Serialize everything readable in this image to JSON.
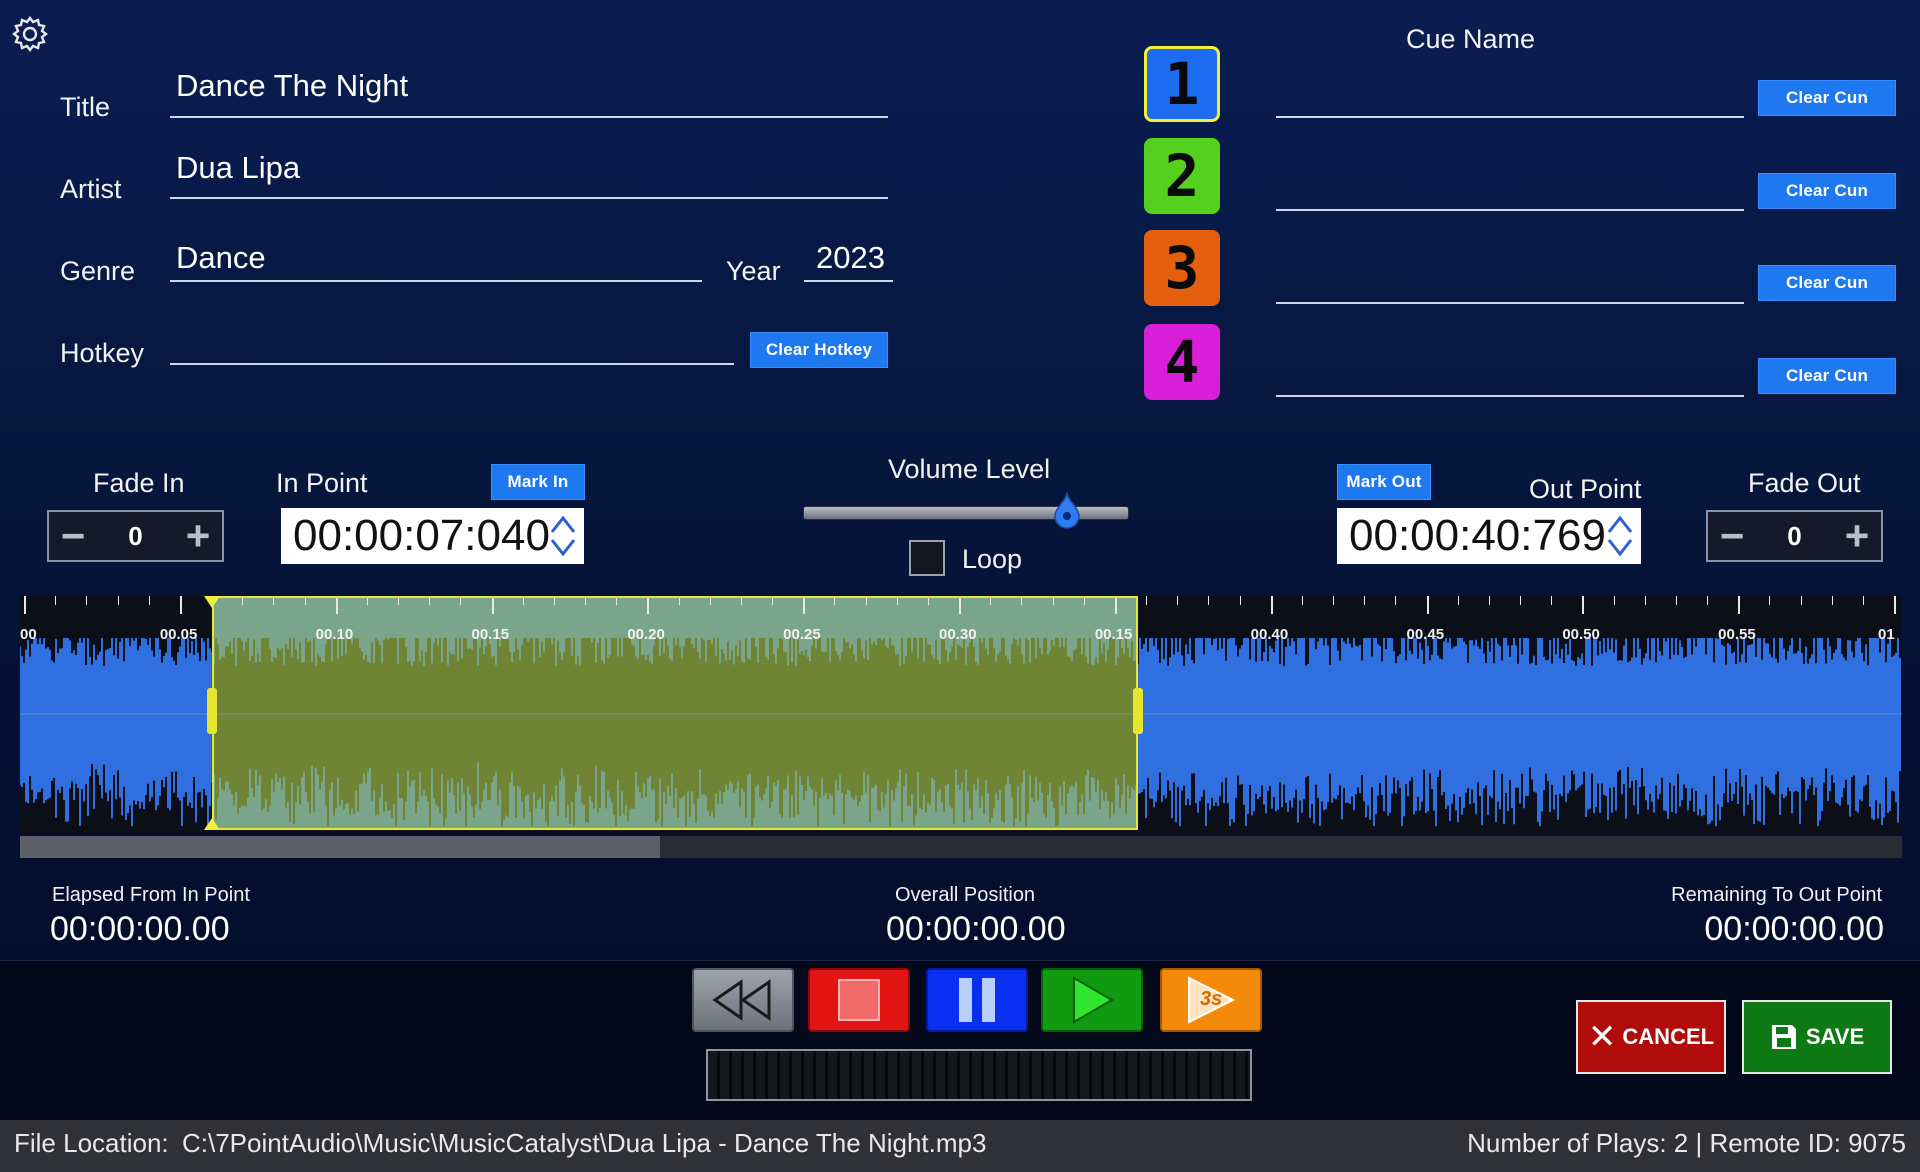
{
  "metadata": {
    "title_label": "Title",
    "title_value": "Dance The Night",
    "artist_label": "Artist",
    "artist_value": "Dua Lipa",
    "genre_label": "Genre",
    "genre_value": "Dance",
    "year_label": "Year",
    "year_value": "2023",
    "hotkey_label": "Hotkey",
    "hotkey_value": "",
    "clear_hotkey_label": "Clear Hotkey"
  },
  "cues": {
    "header": "Cue Name",
    "items": [
      {
        "number": "1",
        "color": "#1e6cf0",
        "border": "#f2f03a",
        "name": "",
        "clear_label": "Clear Cun"
      },
      {
        "number": "2",
        "color": "#53d11e",
        "border": "#53d11e",
        "name": "",
        "clear_label": "Clear Cun"
      },
      {
        "number": "3",
        "color": "#e5600e",
        "border": "#e5600e",
        "name": "",
        "clear_label": "Clear Cun"
      },
      {
        "number": "4",
        "color": "#d61fd6",
        "border": "#d61fd6",
        "name": "",
        "clear_label": "Clear Cun"
      }
    ]
  },
  "controls": {
    "fade_in_label": "Fade In",
    "fade_in_value": "0",
    "in_point_label": "In Point",
    "in_point_value": "00:00:07:040",
    "mark_in_label": "Mark In",
    "volume_label": "Volume Level",
    "volume_level": 0.81,
    "loop_label": "Loop",
    "loop_checked": false,
    "mark_out_label": "Mark Out",
    "out_point_label": "Out Point",
    "out_point_value": "00:00:40:769",
    "fade_out_label": "Fade Out",
    "fade_out_value": "0"
  },
  "waveform": {
    "tick_labels": [
      "00",
      "00.05",
      "00.10",
      "00.15",
      "00.20",
      "00.25",
      "00.30",
      "00.15",
      "00.40",
      "00.45",
      "00.50",
      "00.55",
      "01"
    ],
    "region_start": 0.102,
    "region_end": 0.594,
    "scroll_fraction": 0.34,
    "wave_color": "#2f6fe0",
    "region_color": "#7aa58a"
  },
  "status": {
    "elapsed_label": "Elapsed From In Point",
    "elapsed_value": "00:00:00.00",
    "overall_label": "Overall Position",
    "overall_value": "00:00:00.00",
    "remaining_label": "Remaining To Out Point",
    "remaining_value": "00:00:00.00"
  },
  "transport": {
    "play_3s_label": "3s"
  },
  "actions": {
    "cancel_label": "CANCEL",
    "save_label": "SAVE"
  },
  "footer": {
    "file_location_label": "File Location:",
    "file_location_value": "C:\\7PointAudio\\Music\\MusicCatalyst\\Dua Lipa - Dance The Night.mp3",
    "plays_info": "Number of Plays: 2 | Remote ID: 9075"
  }
}
